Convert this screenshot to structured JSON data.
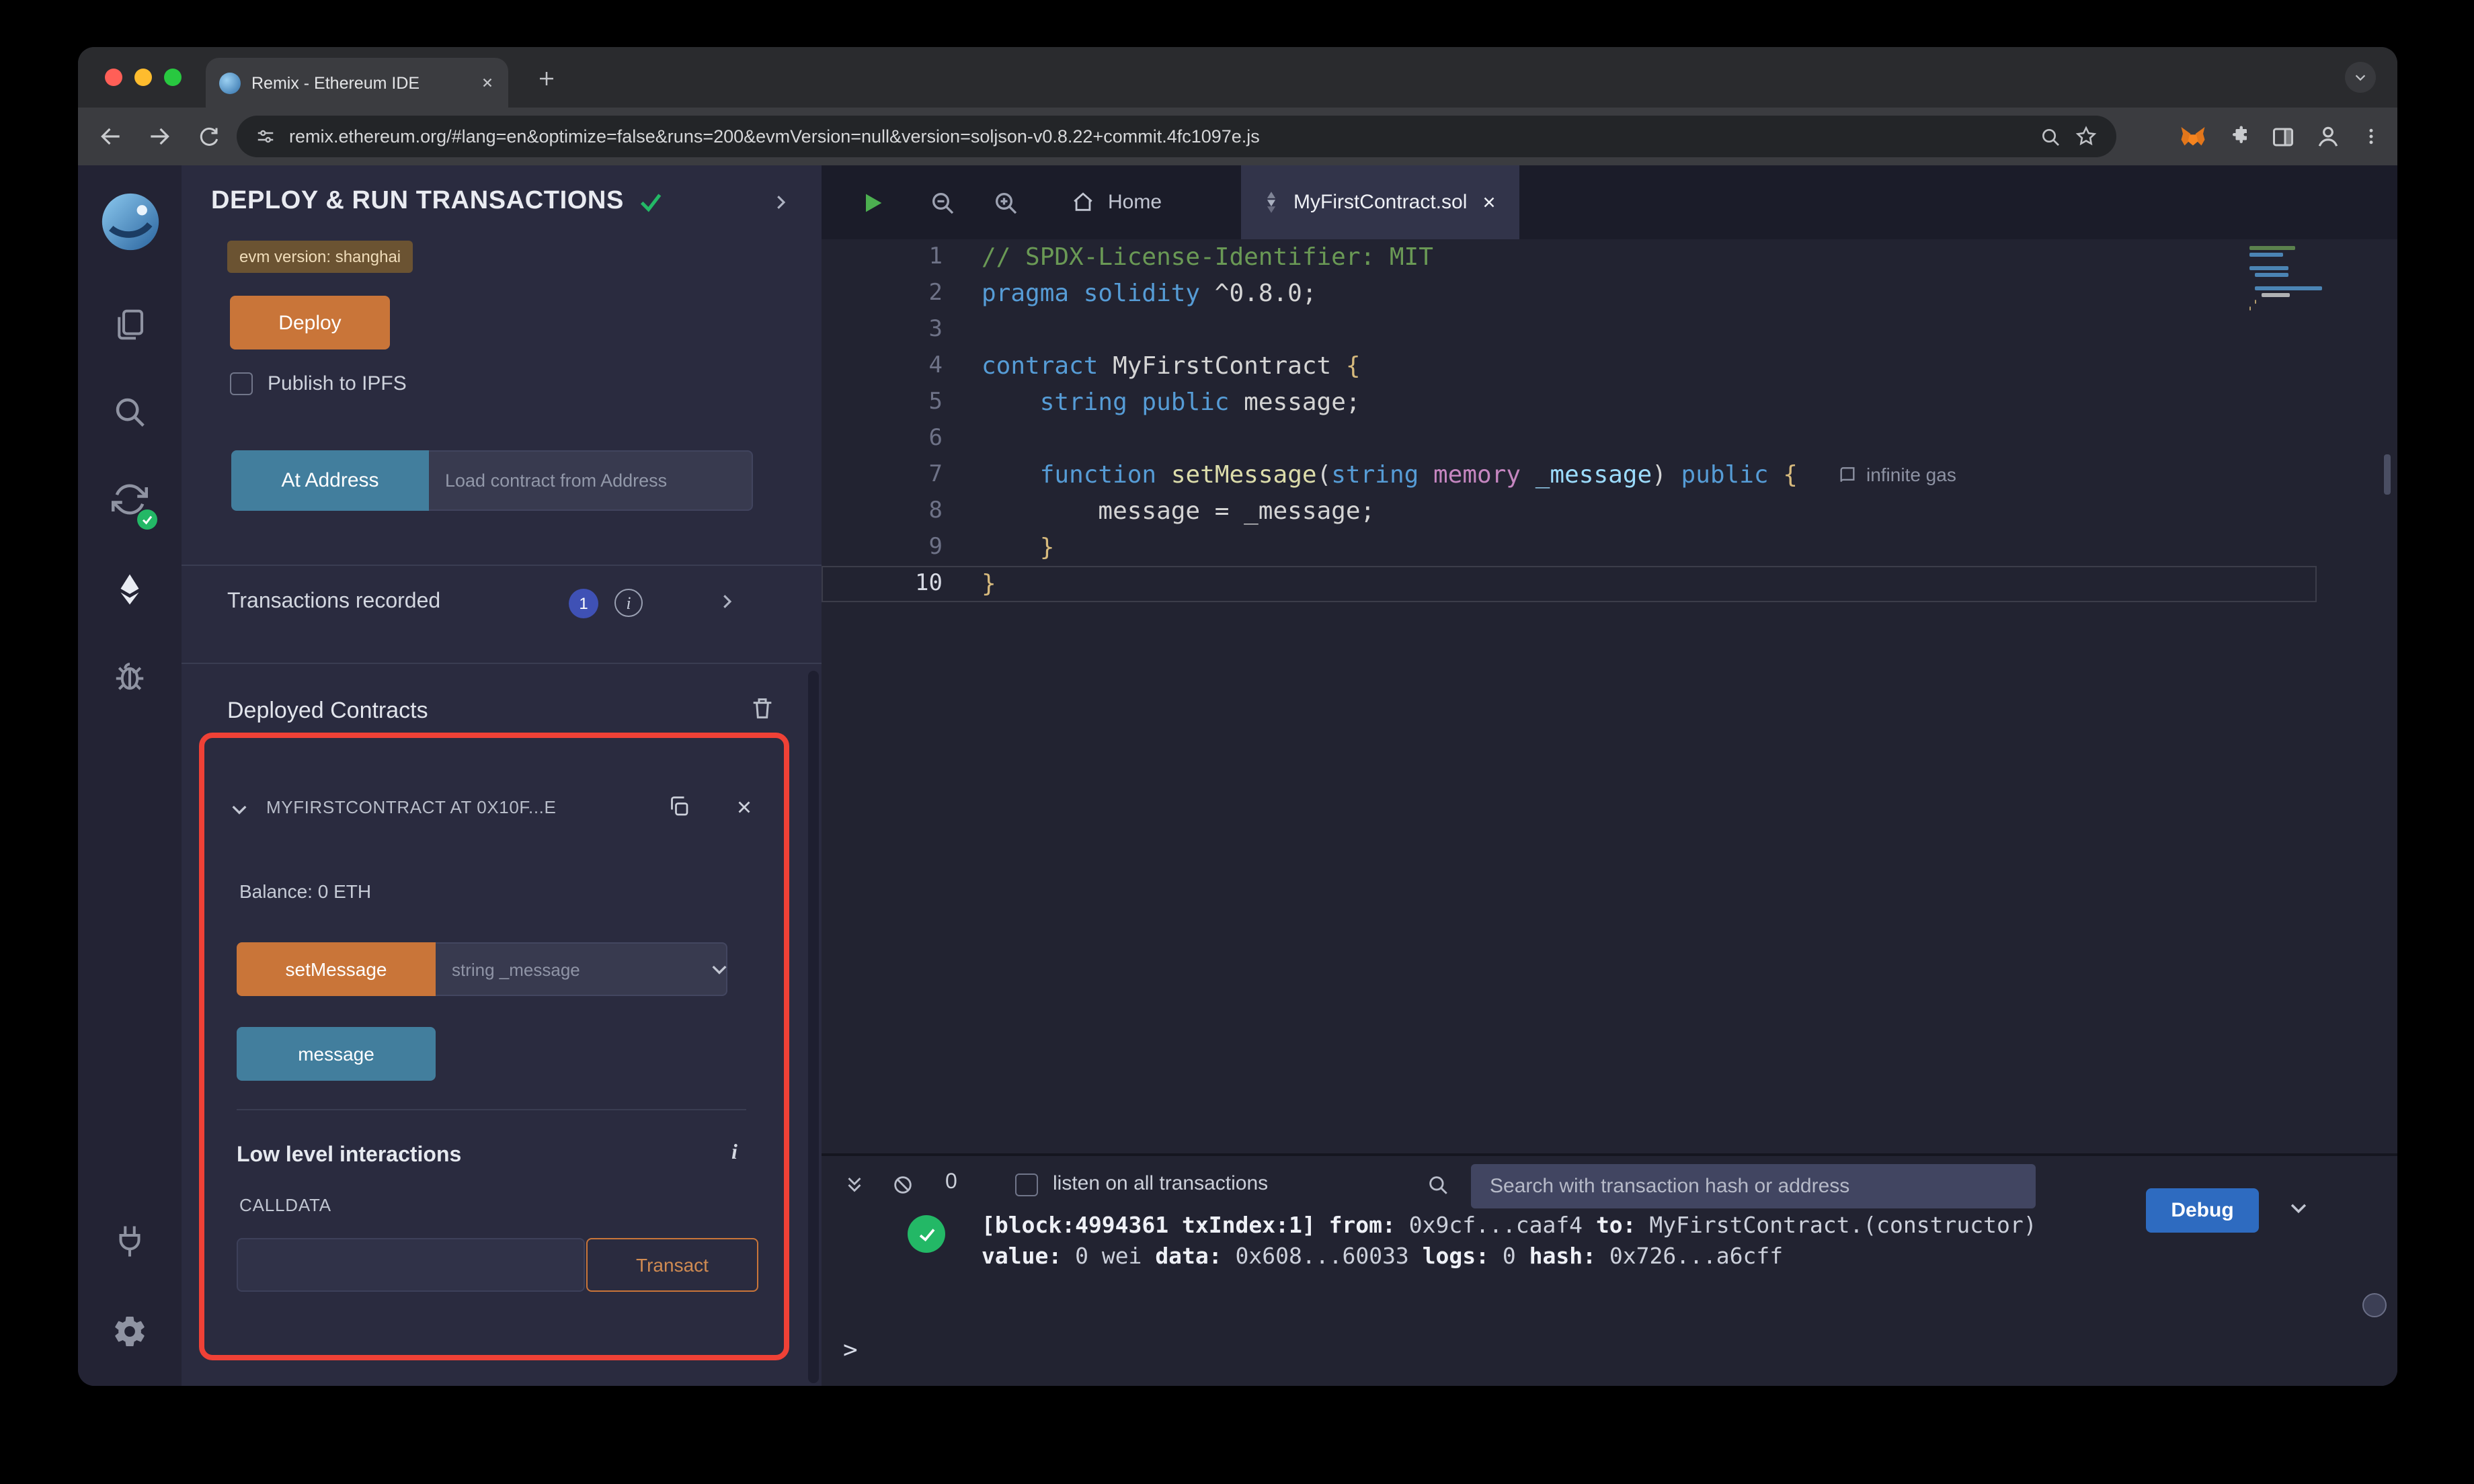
{
  "colors": {
    "accent_orange": "#c97539",
    "accent_teal": "#427e9d",
    "red_highlight": "#ef4136",
    "debug_blue": "#2e6bc0",
    "success_green": "#23b866",
    "badge_blue": "#3f51b5",
    "syntax": {
      "com": "#6a9955",
      "kw": "#569cd6",
      "kw2": "#c586c0",
      "fn": "#dcdcaa",
      "param": "#9cdcfe",
      "brace": "#d7ba7d",
      "pln": "#d4d4d4"
    }
  },
  "browser": {
    "tab_title": "Remix - Ethereum IDE",
    "url": "remix.ethereum.org/#lang=en&optimize=false&runs=200&evmVersion=null&version=soljson-v0.8.22+commit.4fc1097e.js"
  },
  "panel": {
    "title": "DEPLOY & RUN TRANSACTIONS",
    "evm_badge": "evm version: shanghai",
    "deploy_button": "Deploy",
    "publish_label": "Publish to IPFS",
    "at_address_button": "At Address",
    "at_address_placeholder": "Load contract from Address",
    "tx_recorded_label": "Transactions recorded",
    "tx_count": "1",
    "deployed_heading": "Deployed Contracts",
    "contract": {
      "header": "MYFIRSTCONTRACT AT 0X10F...E",
      "balance": "Balance: 0 ETH",
      "set_message_button": "setMessage",
      "set_message_placeholder": "string _message",
      "message_button": "message",
      "low_level_label": "Low level interactions",
      "calldata_label": "CALLDATA",
      "transact_button": "Transact"
    }
  },
  "editor": {
    "tabs": {
      "home": "Home",
      "file": "MyFirstContract.sol"
    },
    "gas_annotation": "infinite gas",
    "lines": [
      {
        "n": "1",
        "tokens": [
          {
            "c": "com",
            "t": "// SPDX-License-Identifier: MIT"
          }
        ]
      },
      {
        "n": "2",
        "tokens": [
          {
            "c": "kw",
            "t": "pragma solidity"
          },
          {
            "c": "pln",
            "t": " ^0.8.0;"
          }
        ]
      },
      {
        "n": "3",
        "tokens": []
      },
      {
        "n": "4",
        "tokens": [
          {
            "c": "kw",
            "t": "contract"
          },
          {
            "c": "pln",
            "t": " MyFirstContract "
          },
          {
            "c": "brace",
            "t": "{"
          }
        ]
      },
      {
        "n": "5",
        "tokens": [
          {
            "c": "pln",
            "t": "    "
          },
          {
            "c": "kw",
            "t": "string public"
          },
          {
            "c": "pln",
            "t": " message;"
          }
        ]
      },
      {
        "n": "6",
        "tokens": []
      },
      {
        "n": "7",
        "gas": true,
        "tokens": [
          {
            "c": "pln",
            "t": "    "
          },
          {
            "c": "kw",
            "t": "function"
          },
          {
            "c": "pln",
            "t": " "
          },
          {
            "c": "fn",
            "t": "setMessage"
          },
          {
            "c": "pln",
            "t": "("
          },
          {
            "c": "kw",
            "t": "string"
          },
          {
            "c": "pln",
            "t": " "
          },
          {
            "c": "kw2",
            "t": "memory"
          },
          {
            "c": "pln",
            "t": " "
          },
          {
            "c": "param",
            "t": "_message"
          },
          {
            "c": "pln",
            "t": ") "
          },
          {
            "c": "kw",
            "t": "public"
          },
          {
            "c": "pln",
            "t": " "
          },
          {
            "c": "brace",
            "t": "{"
          }
        ]
      },
      {
        "n": "8",
        "tokens": [
          {
            "c": "pln",
            "t": "        message = _message;"
          }
        ]
      },
      {
        "n": "9",
        "tokens": [
          {
            "c": "pln",
            "t": "    "
          },
          {
            "c": "brace",
            "t": "}"
          }
        ]
      },
      {
        "n": "10",
        "active": true,
        "tokens": [
          {
            "c": "brace",
            "t": "}"
          }
        ]
      }
    ]
  },
  "terminal": {
    "count": "0",
    "listen_label": "listen on all transactions",
    "search_placeholder": "Search with transaction hash or address",
    "debug_button": "Debug",
    "prompt": ">",
    "log_lines": [
      [
        {
          "b": true,
          "t": "[block:4994361 txIndex:1] "
        },
        {
          "b": true,
          "t": "from:"
        },
        {
          "t": " 0x9cf...caaf4 "
        },
        {
          "b": true,
          "t": "to:"
        },
        {
          "t": " MyFirstContract.(constructor)"
        }
      ],
      [
        {
          "b": true,
          "t": "value:"
        },
        {
          "t": " 0 wei "
        },
        {
          "b": true,
          "t": "data:"
        },
        {
          "t": " 0x608...60033 "
        },
        {
          "b": true,
          "t": "logs:"
        },
        {
          "t": " 0 "
        },
        {
          "b": true,
          "t": "hash:"
        },
        {
          "t": " 0x726...a6cff"
        }
      ]
    ]
  }
}
